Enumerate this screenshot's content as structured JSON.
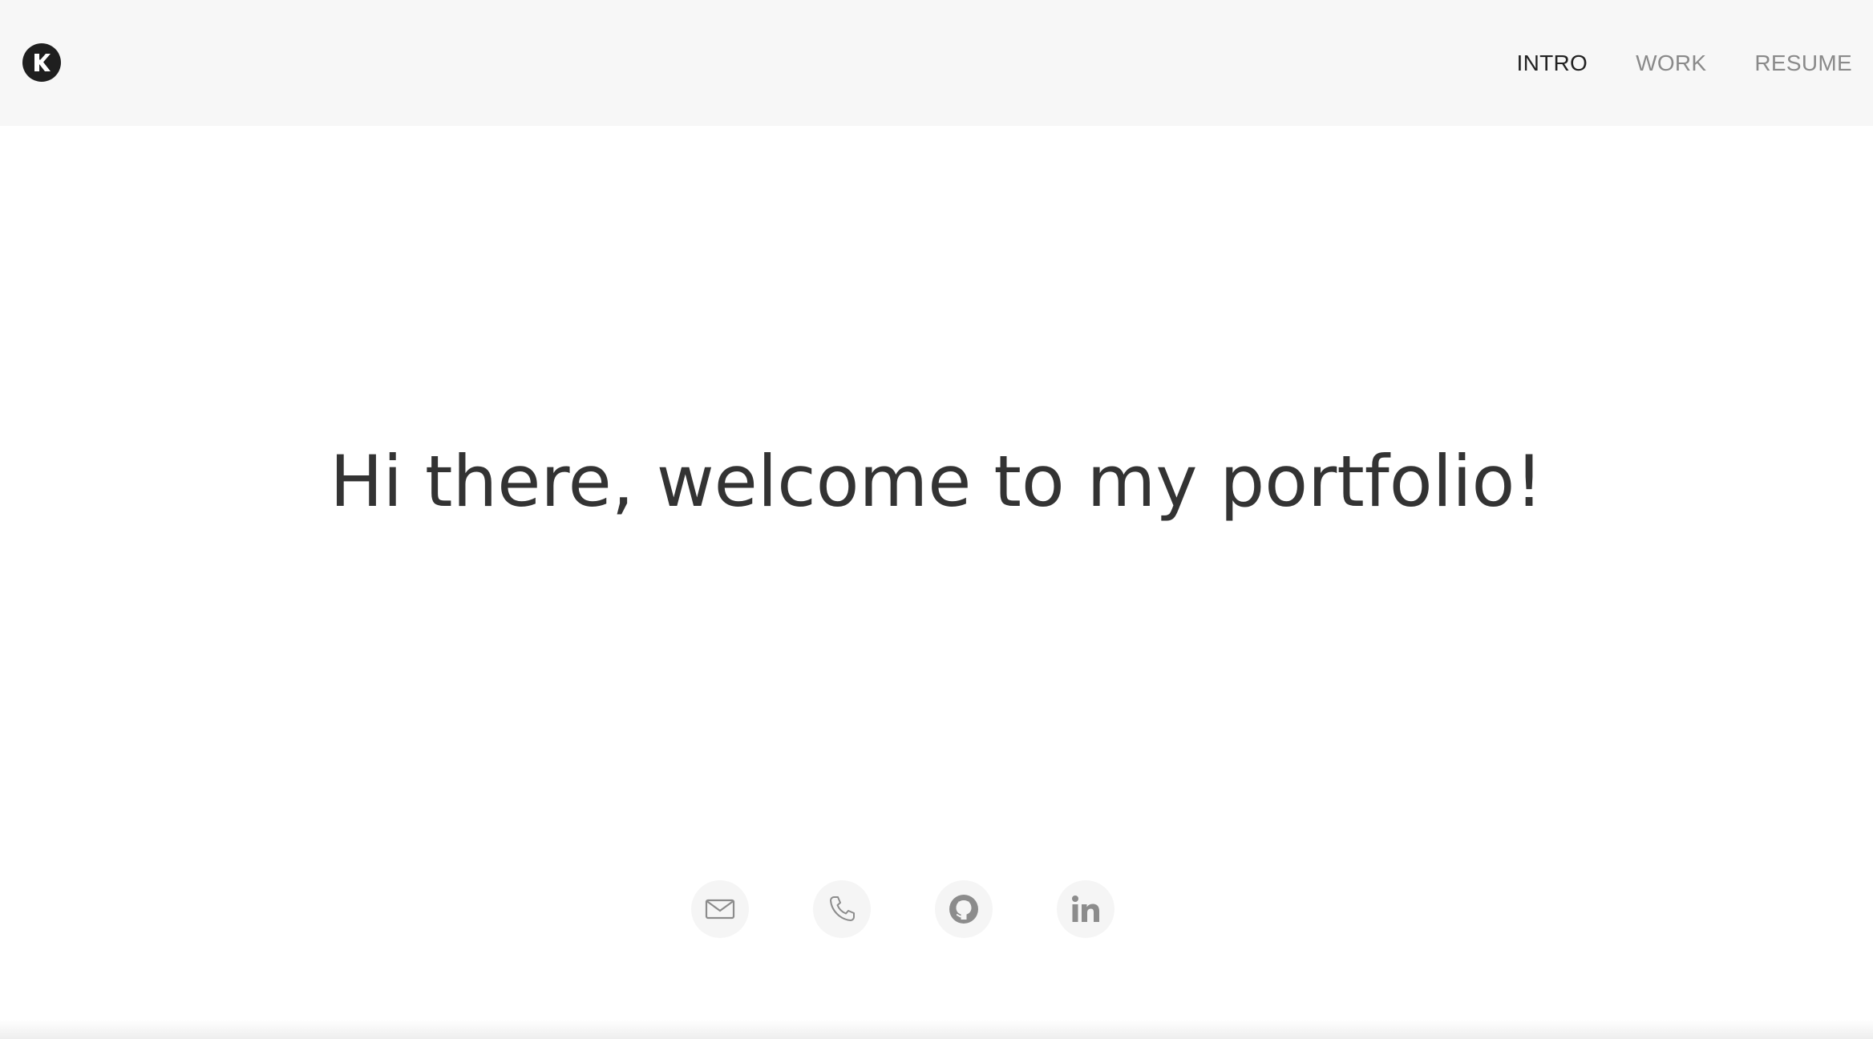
{
  "header": {
    "logo": {
      "icon": "k-monogram-logo-icon",
      "letter": "K"
    },
    "nav": [
      {
        "label": "INTRO",
        "active": true
      },
      {
        "label": "WORK",
        "active": false
      },
      {
        "label": "RESUME",
        "active": false
      }
    ]
  },
  "hero": {
    "headline": "Hi there, welcome to my portfolio!"
  },
  "socials": [
    {
      "icon": "mail-icon"
    },
    {
      "icon": "phone-icon"
    },
    {
      "icon": "github-icon"
    },
    {
      "icon": "linkedin-icon"
    }
  ],
  "colors": {
    "header_bg": "#f7f7f7",
    "nav_active": "#222222",
    "nav_inactive": "#8a8a8a",
    "headline": "#333333",
    "icon": "#8c8c8c",
    "icon_bg": "#f5f5f5"
  }
}
